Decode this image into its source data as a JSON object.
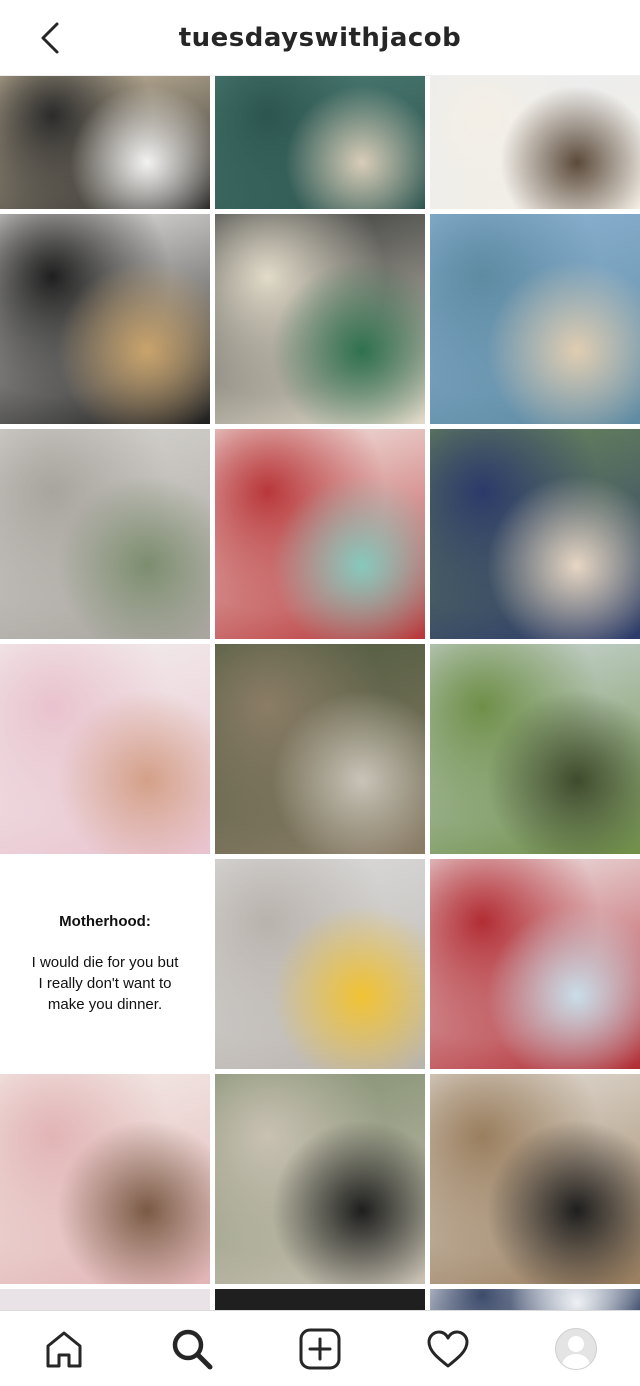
{
  "header": {
    "username": "tuesdayswithjacob",
    "back_icon": "chevron-left-icon"
  },
  "posts": [
    {
      "name": "soccer-gear-photo",
      "colors": [
        "#d7c7a9",
        "#2b2b2b",
        "#f2f2f2"
      ]
    },
    {
      "name": "aquarium-photo",
      "colors": [
        "#4d7d74",
        "#2d5550",
        "#d9cdb8"
      ]
    },
    {
      "name": "beach-table-photo",
      "colors": [
        "#e9ecef",
        "#f4efe6",
        "#5b4a3a"
      ]
    },
    {
      "name": "candy-catcher-photo",
      "colors": [
        "#f3f1ee",
        "#1f1f1f",
        "#c9a36b"
      ]
    },
    {
      "name": "coffee-bag-photo",
      "colors": [
        "#2c2f30",
        "#e2dbc9",
        "#2f7150"
      ]
    },
    {
      "name": "beach-splash-photo",
      "colors": [
        "#8fb6d6",
        "#5e8aa2",
        "#e0cdb1"
      ]
    },
    {
      "name": "yesteryear-village-photo",
      "colors": [
        "#d8d6d2",
        "#a8a49e",
        "#7c8d6e"
      ]
    },
    {
      "name": "easter-basket-photo",
      "colors": [
        "#f5f1ec",
        "#b9373a",
        "#87c8bc"
      ]
    },
    {
      "name": "pizza-shirt-boy-photo",
      "colors": [
        "#6d8a5b",
        "#2b3a6a",
        "#e7d6c4"
      ]
    },
    {
      "name": "sprinkle-cookies-photo",
      "colors": [
        "#f3f0ee",
        "#e9c3cf",
        "#d4a088"
      ]
    },
    {
      "name": "boardwalk-photo",
      "colors": [
        "#4c5a3d",
        "#8b7c66",
        "#c9c4b8"
      ]
    },
    {
      "name": "sunny-street-photo",
      "colors": [
        "#cfd9dd",
        "#6f8f48",
        "#3f4b2d"
      ]
    },
    {
      "name": "motherhood-quote",
      "colors": [
        "#ffffff",
        "#ffffff",
        "#ffffff"
      ]
    },
    {
      "name": "snow-boy-photo",
      "colors": [
        "#dedede",
        "#b9b3ad",
        "#f1c232"
      ]
    },
    {
      "name": "shark-snack-photo",
      "colors": [
        "#f2f2f2",
        "#b22d34",
        "#c9dde8"
      ]
    },
    {
      "name": "homework-boy-photo",
      "colors": [
        "#f4efea",
        "#e2b4b6",
        "#7a5a44"
      ]
    },
    {
      "name": "wizard-walk-photo",
      "colors": [
        "#7e8d6d",
        "#c9c1b3",
        "#1e1e1e"
      ]
    },
    {
      "name": "wizard-kids-photo",
      "colors": [
        "#e6e2dc",
        "#9a7e5e",
        "#1e1e1e"
      ]
    },
    {
      "name": "partial-photo-1",
      "colors": [
        "#e9e3e8",
        "#e9e3e8",
        "#e9e3e8"
      ]
    },
    {
      "name": "partial-photo-2",
      "colors": [
        "#1f1f1f",
        "#1f1f1f",
        "#1f1f1f"
      ]
    },
    {
      "name": "partial-photo-3",
      "colors": [
        "#eef1f4",
        "#3d4b6b",
        "#eef1f4"
      ]
    }
  ],
  "quote": {
    "title": "Motherhood:",
    "line1": "I would die for you but",
    "line2": "I really don't want to",
    "line3": "make you dinner."
  },
  "nav": {
    "items": [
      "home-icon",
      "search-icon",
      "new-post-icon",
      "heart-icon",
      "profile-avatar"
    ]
  }
}
